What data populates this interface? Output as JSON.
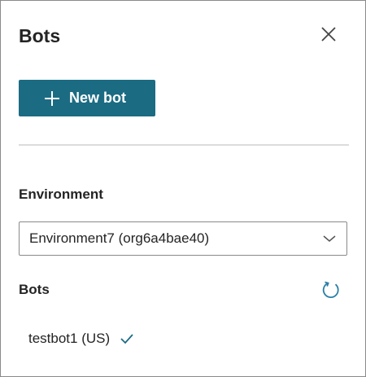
{
  "panel": {
    "title": "Bots",
    "close_icon": "close-icon"
  },
  "new_bot_button": {
    "icon": "plus-icon",
    "label": "New bot"
  },
  "environment": {
    "label": "Environment",
    "selected_value": "Environment7 (org6a4bae40)",
    "dropdown_icon": "chevron-down-icon"
  },
  "bots_section": {
    "label": "Bots",
    "refresh_icon": "refresh-icon",
    "items": [
      {
        "name": "testbot1 (US)",
        "status_icon": "checkmark-icon"
      }
    ]
  },
  "colors": {
    "accent": "#1b6b83",
    "icon_blue": "#2a7fa8",
    "text": "#242424",
    "border": "#8a8a8a"
  }
}
